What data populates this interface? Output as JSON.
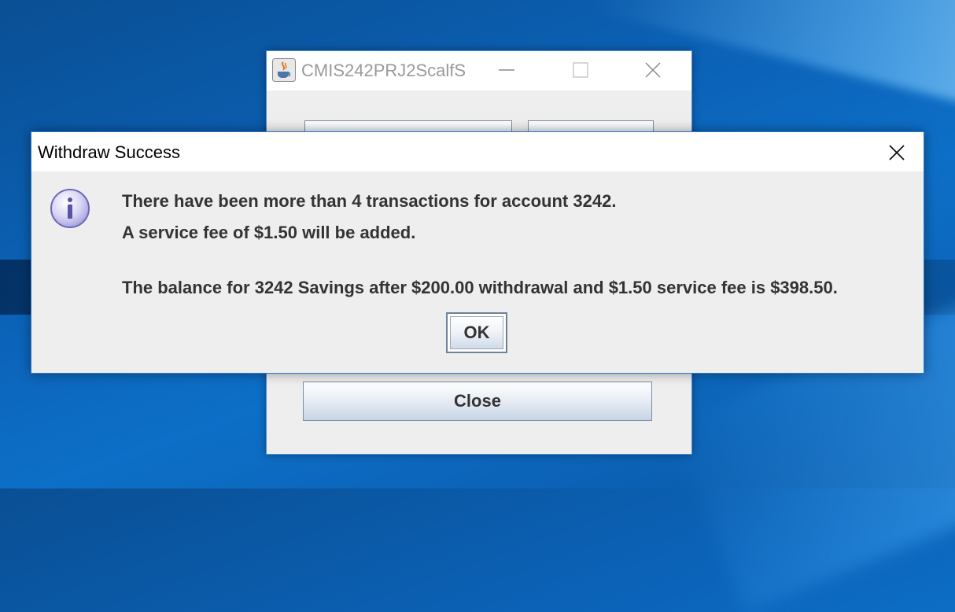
{
  "main_window": {
    "title": "CMIS242PRJ2ScalfS",
    "close_button_label": "Close"
  },
  "dialog": {
    "title": "Withdraw Success",
    "line1": "There have been more than 4 transactions for account 3242.",
    "line2": "A service fee of $1.50 will be added.",
    "line3": "The balance for 3242 Savings after $200.00 withdrawal and $1.50 service fee is $398.50.",
    "ok_label": "OK"
  },
  "icons": {
    "app": "java-icon",
    "info": "info-icon",
    "close": "close-icon",
    "minimize": "minimize-icon",
    "maximize": "maximize-icon"
  },
  "colors": {
    "desktop": "#0b62b7",
    "dialog_border": "#2b79cc",
    "text": "#333333"
  }
}
